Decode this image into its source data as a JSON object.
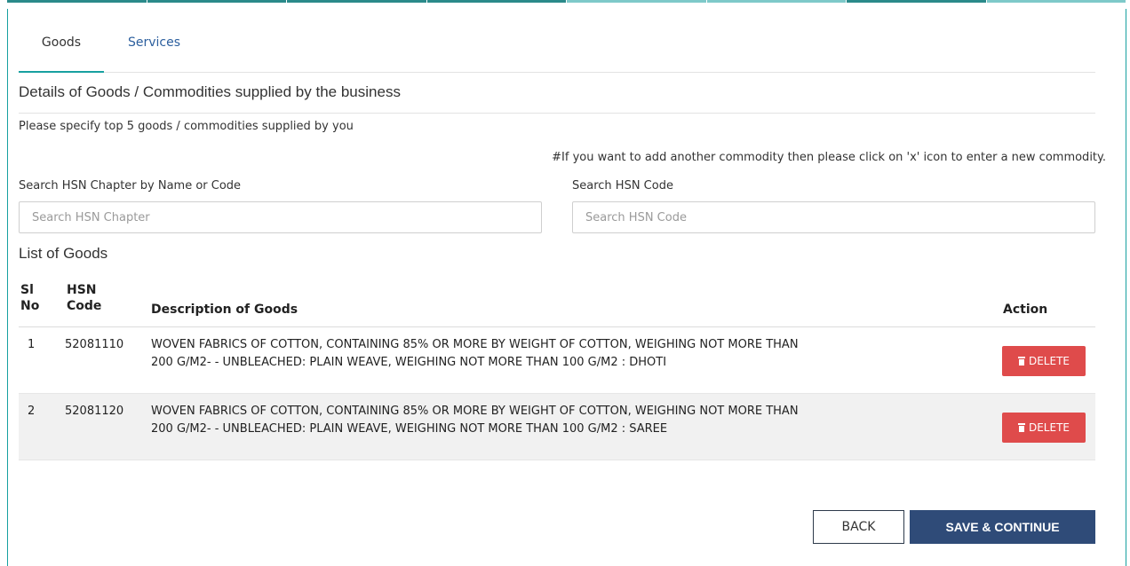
{
  "tabs": [
    {
      "label": "Goods",
      "active": true
    },
    {
      "label": "Services",
      "active": false
    }
  ],
  "section_title": "Details of Goods / Commodities supplied by the business",
  "instruction": "Please specify top 5 goods / commodities supplied by you",
  "note": "#If you want to add another commodity then please click on 'x' icon to enter a new commodity.",
  "search": {
    "chapter_label": "Search HSN Chapter by Name or Code",
    "chapter_placeholder": "Search HSN Chapter",
    "chapter_value": "",
    "code_label": "Search HSN Code",
    "code_placeholder": "Search HSN Code",
    "code_value": ""
  },
  "list_title": "List of Goods",
  "table": {
    "headers": {
      "sl_line1": "Sl",
      "sl_line2": "No",
      "hsn_line1": "HSN",
      "hsn_line2": "Code",
      "description": "Description of Goods",
      "action": "Action"
    },
    "rows": [
      {
        "sl": "1",
        "hsn": "52081110",
        "description_line1": "WOVEN FABRICS OF COTTON, CONTAINING 85% OR MORE BY WEIGHT OF COTTON, WEIGHING NOT MORE THAN",
        "description_line2": "200 G/M2- - UNBLEACHED: PLAIN WEAVE, WEIGHING NOT MORE THAN 100 G/M2 : DHOTI",
        "action_label": "DELETE"
      },
      {
        "sl": "2",
        "hsn": "52081120",
        "description_line1": "WOVEN FABRICS OF COTTON, CONTAINING 85% OR MORE BY WEIGHT OF COTTON, WEIGHING NOT MORE THAN",
        "description_line2": "200 G/M2- - UNBLEACHED: PLAIN WEAVE, WEIGHING NOT MORE THAN 100 G/M2 : SAREE",
        "action_label": "DELETE"
      }
    ]
  },
  "buttons": {
    "back": "BACK",
    "save": "SAVE & CONTINUE"
  },
  "icons": {
    "delete": "trash-icon"
  },
  "colors": {
    "accent": "#17a0a0",
    "link": "#2c5f9e",
    "delete": "#df4b4b",
    "primary": "#2f4b78",
    "row_alt": "#f1f1f1"
  }
}
